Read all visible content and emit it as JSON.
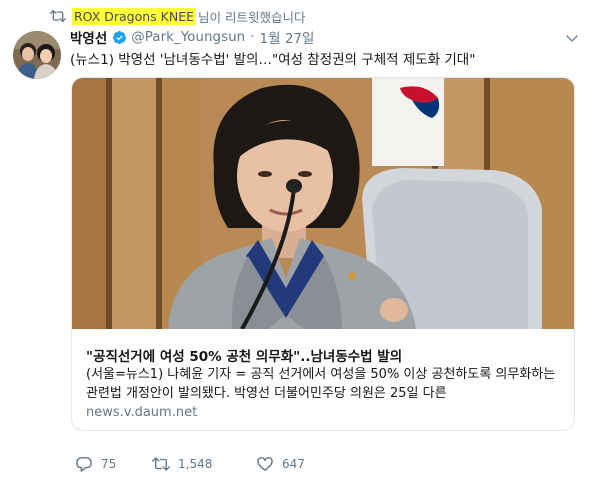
{
  "retweet_context": {
    "icon": "retweet-icon",
    "user": "ROX Dragons KNEE",
    "suffix": "님이 리트윗했습니다",
    "highlight_color": "#ffff3a"
  },
  "tweet": {
    "author_name": "박영선",
    "verified_icon": "verified-badge-icon",
    "handle": "@Park_Youngsun",
    "separator": "·",
    "date": "1월 27일",
    "text": "(뉴스1) 박영선 '남녀동수법' 발의…\"여성 참정권의 구체적 제도화 기대\"",
    "caret_icon": "chevron-down-icon"
  },
  "card": {
    "title": "\"공직선거에 여성 50% 공천 의무화\"..남녀동수법 발의",
    "description": "(서울=뉴스1) 나혜윤 기자 = 공직 선거에서 여성을 50% 이상 공천하도록 의무화하는 관련법 개정안이 발의됐다. 박영선 더불어민주당 의원은 25일 다른",
    "domain": "news.v.daum.net"
  },
  "actions": {
    "reply_count": "75",
    "retweet_count": "1,548",
    "like_count": "647"
  },
  "colors": {
    "accent": "#1da1f2",
    "secondary_text": "#657786",
    "border": "#e1e8ed"
  }
}
